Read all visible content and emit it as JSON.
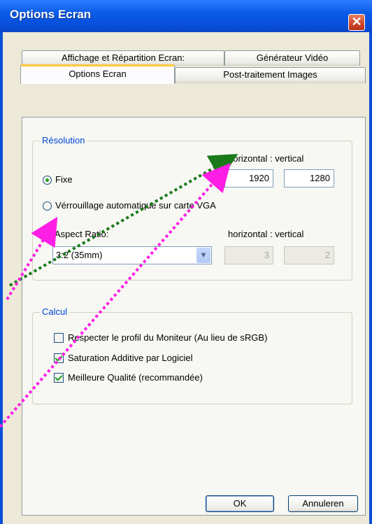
{
  "window": {
    "title": "Options Ecran",
    "close": "✕"
  },
  "tabs": {
    "row_back": [
      "Affichage et Répartition Ecran:",
      "Générateur Vidéo"
    ],
    "row_front": [
      "Options Ecran",
      "Post-traitement Images"
    ],
    "active": "Options Ecran"
  },
  "resolution": {
    "group_label": "Résolution",
    "header": "horizontal : vertical",
    "fixed_label": "Fixe",
    "fixed_checked": true,
    "width": "1920",
    "height": "1280",
    "auto_label": "Vérrouillage automatique sur carte VGA",
    "auto_checked": false,
    "aspect_label": "Aspect Ratio:",
    "aspect_header": "horizontal : vertical",
    "aspect_value": "3:2 (35mm)",
    "aspect_h": "3",
    "aspect_v": "2"
  },
  "calcul": {
    "group_label": "Calcul",
    "options": [
      {
        "label": "Respecter le profil du Moniteur (Au lieu de sRGB)",
        "checked": false
      },
      {
        "label": "Saturation Additive par Logiciel",
        "checked": true
      },
      {
        "label": "Meilleure Qualité (recommandée)",
        "checked": true
      }
    ]
  },
  "buttons": {
    "ok": "OK",
    "cancel": "Annuleren"
  },
  "colors": {
    "annotation_green": "#1a7a1a",
    "annotation_magenta": "#ff1ee6"
  }
}
